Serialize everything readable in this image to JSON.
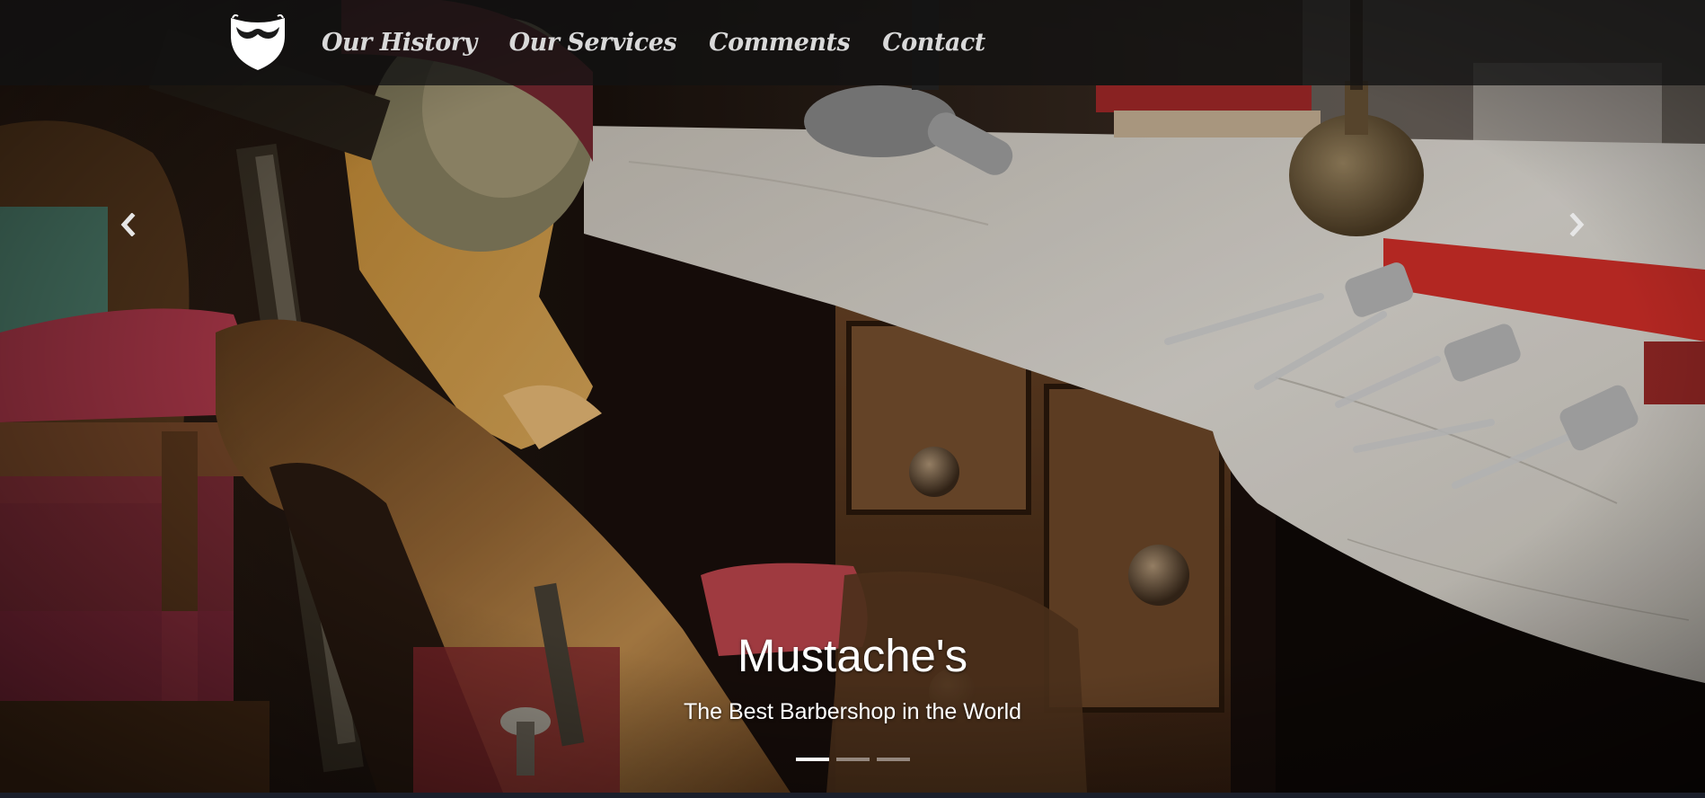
{
  "nav": {
    "logo_icon": "mustache-beard-shield-icon",
    "links": [
      {
        "label": "Our History"
      },
      {
        "label": "Our Services"
      },
      {
        "label": "Comments"
      },
      {
        "label": "Contact"
      }
    ]
  },
  "carousel": {
    "prev_icon": "chevron-left-icon",
    "next_icon": "chevron-right-icon",
    "title": "Mustache's",
    "subtitle": "The Best Barbershop in the World",
    "slide_count": 3,
    "active_slide": 1,
    "background_image": "barbershop-chair-and-marble-counter-with-clippers"
  },
  "colors": {
    "navbar_bg": "#121212",
    "nav_text": "#d9d9d9",
    "caption_text": "#ffffff",
    "indicator_active": "#ffffff",
    "bottom_strip": "#1b1f2b"
  }
}
